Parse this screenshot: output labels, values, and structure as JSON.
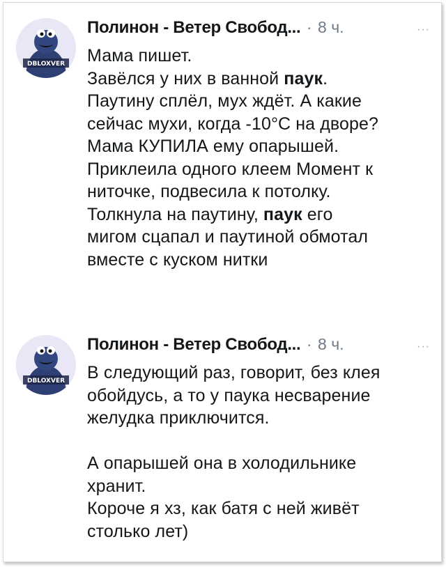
{
  "posts": [
    {
      "author": "Полинон - Ветер Свобод...",
      "dot": "·",
      "time": "8 ч.",
      "more": "···",
      "avatar_icon": "cookie-monster-avatar-icon",
      "avatar_caption": "DBLOXVER",
      "lines": [
        {
          "pre": "Мама пишет.",
          "bold": "",
          "post": ""
        },
        {
          "pre": "Завёлся у них в ванной ",
          "bold": "паук",
          "post": "."
        },
        {
          "pre": "Паутину сплёл, мух ждёт. А какие",
          "bold": "",
          "post": ""
        },
        {
          "pre": "сейчас мухи, когда -10°С на дворе?",
          "bold": "",
          "post": ""
        },
        {
          "pre": "Мама КУПИЛА ему опарышей.",
          "bold": "",
          "post": ""
        },
        {
          "pre": "Приклеила одного клеем Момент к",
          "bold": "",
          "post": ""
        },
        {
          "pre": "ниточке, подвесила к потолку.",
          "bold": "",
          "post": ""
        },
        {
          "pre": "Толкнула на паутину, ",
          "bold": "паук",
          "post": " его"
        },
        {
          "pre": "мигом сцапал и паутиной обмотал",
          "bold": "",
          "post": ""
        },
        {
          "pre": "вместе с куском нитки",
          "bold": "",
          "post": ""
        }
      ]
    },
    {
      "author": "Полинон - Ветер Свобод...",
      "dot": "·",
      "time": "8 ч.",
      "more": "···",
      "avatar_icon": "cookie-monster-avatar-icon",
      "avatar_caption": "DBLOXVER",
      "lines": [
        {
          "pre": "В следующий раз, говорит, без клея",
          "bold": "",
          "post": ""
        },
        {
          "pre": "обойдусь, а то у паука несварение",
          "bold": "",
          "post": ""
        },
        {
          "pre": "желудка приключится.",
          "bold": "",
          "post": ""
        },
        {
          "pre": "",
          "bold": "",
          "post": "",
          "blank": true
        },
        {
          "pre": "А опарышей она в холодильнике",
          "bold": "",
          "post": ""
        },
        {
          "pre": "хранит.",
          "bold": "",
          "post": ""
        },
        {
          "pre": "Короче я хз, как батя с ней живёт",
          "bold": "",
          "post": ""
        },
        {
          "pre": "столько лет)",
          "bold": "",
          "post": ""
        }
      ]
    }
  ],
  "colors": {
    "text": "#14171a",
    "muted": "#6e7a86",
    "avatar_bg": "#e9e7f5",
    "avatar_fur": "#2e3f73"
  }
}
